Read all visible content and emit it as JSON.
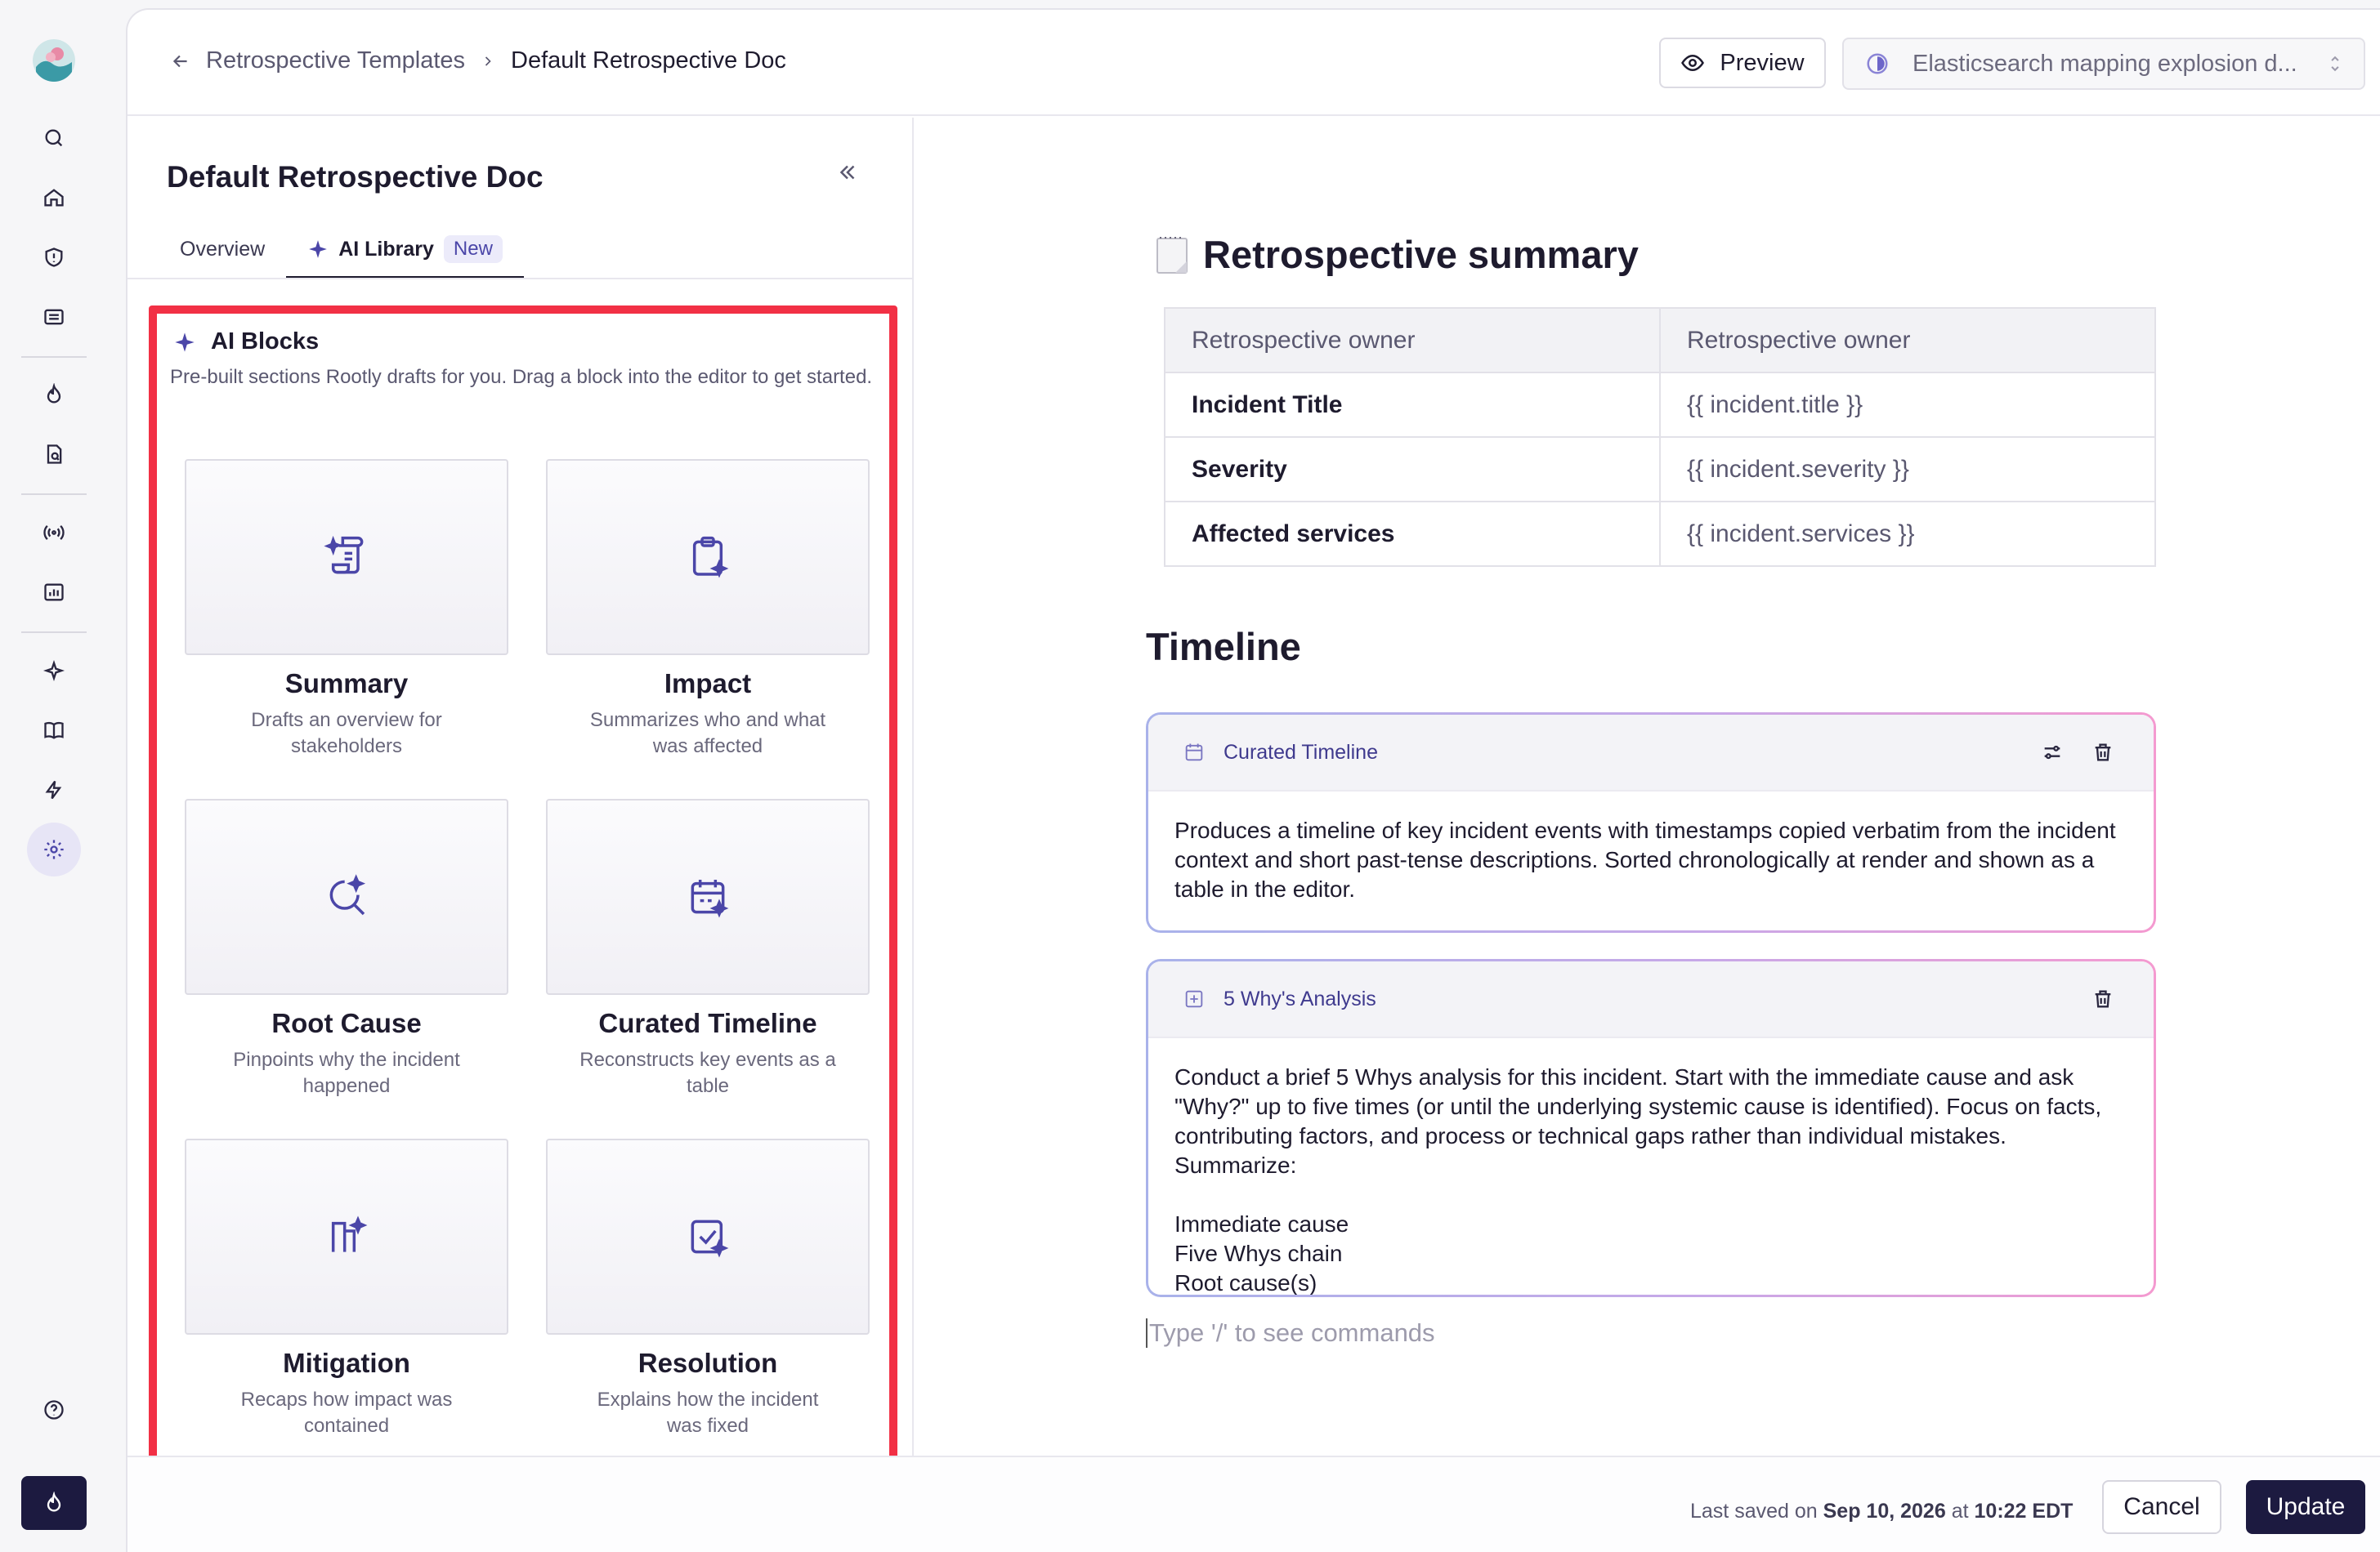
{
  "breadcrumb": {
    "parent": "Retrospective Templates",
    "current": "Default Retrospective Doc"
  },
  "header": {
    "preview_label": "Preview",
    "incident_select_value": "Elasticsearch mapping explosion d..."
  },
  "side_panel": {
    "title": "Default Retrospective Doc",
    "tabs": [
      {
        "label": "Overview"
      },
      {
        "label": "AI Library",
        "badge": "New"
      }
    ],
    "ai_blocks": {
      "title": "AI Blocks",
      "description": "Pre-built sections Rootly drafts for you. Drag a block into the editor to get started.",
      "blocks": [
        {
          "title": "Summary",
          "description": "Drafts an overview for stakeholders",
          "icon": "summary-scroll-icon"
        },
        {
          "title": "Impact",
          "description": "Summarizes who and what was affected",
          "icon": "impact-clipboard-icon"
        },
        {
          "title": "Root Cause",
          "description": "Pinpoints why the incident happened",
          "icon": "root-cause-search-icon"
        },
        {
          "title": "Curated Timeline",
          "description": "Reconstructs key events as a table",
          "icon": "timeline-calendar-icon"
        },
        {
          "title": "Mitigation",
          "description": "Recaps how impact was contained",
          "icon": "mitigation-chart-icon"
        },
        {
          "title": "Resolution",
          "description": "Explains how the incident was fixed",
          "icon": "resolution-check-icon"
        }
      ]
    }
  },
  "editor": {
    "summary_heading": "Retrospective summary",
    "summary_table": {
      "header": [
        "Retrospective owner",
        "Retrospective owner"
      ],
      "rows": [
        [
          "Incident Title",
          "{{ incident.title }}"
        ],
        [
          "Severity",
          "{{ incident.severity }}"
        ],
        [
          "Affected services",
          "{{ incident.services }}"
        ]
      ]
    },
    "timeline_heading": "Timeline",
    "blocks": [
      {
        "label": "Curated Timeline",
        "body": "Produces a timeline of key incident events with timestamps copied verbatim from the incident context and short past-tense descriptions. Sorted chronologically at render and shown as a table in the editor."
      },
      {
        "label": "5 Why's Analysis",
        "body_paragraph": "Conduct a brief 5 Whys analysis for this incident. Start with the immediate cause and ask \"Why?\" up to five times (or until the underlying systemic cause is identified). Focus on facts, contributing factors, and process or technical gaps rather than individual mistakes. Summarize:",
        "body_list": [
          "Immediate cause",
          "Five Whys chain",
          "Root cause(s)"
        ]
      }
    ],
    "slash_placeholder": "Type '/' to see commands"
  },
  "footer": {
    "saved_prefix": "Last saved on",
    "saved_date": "Sep 10, 2026",
    "saved_at": "at",
    "saved_time": "10:22 EDT",
    "cancel_label": "Cancel",
    "update_label": "Update"
  },
  "colors": {
    "accent": "#4b46a8",
    "primary_button": "#1c1a40",
    "highlight_border": "#f23045"
  }
}
